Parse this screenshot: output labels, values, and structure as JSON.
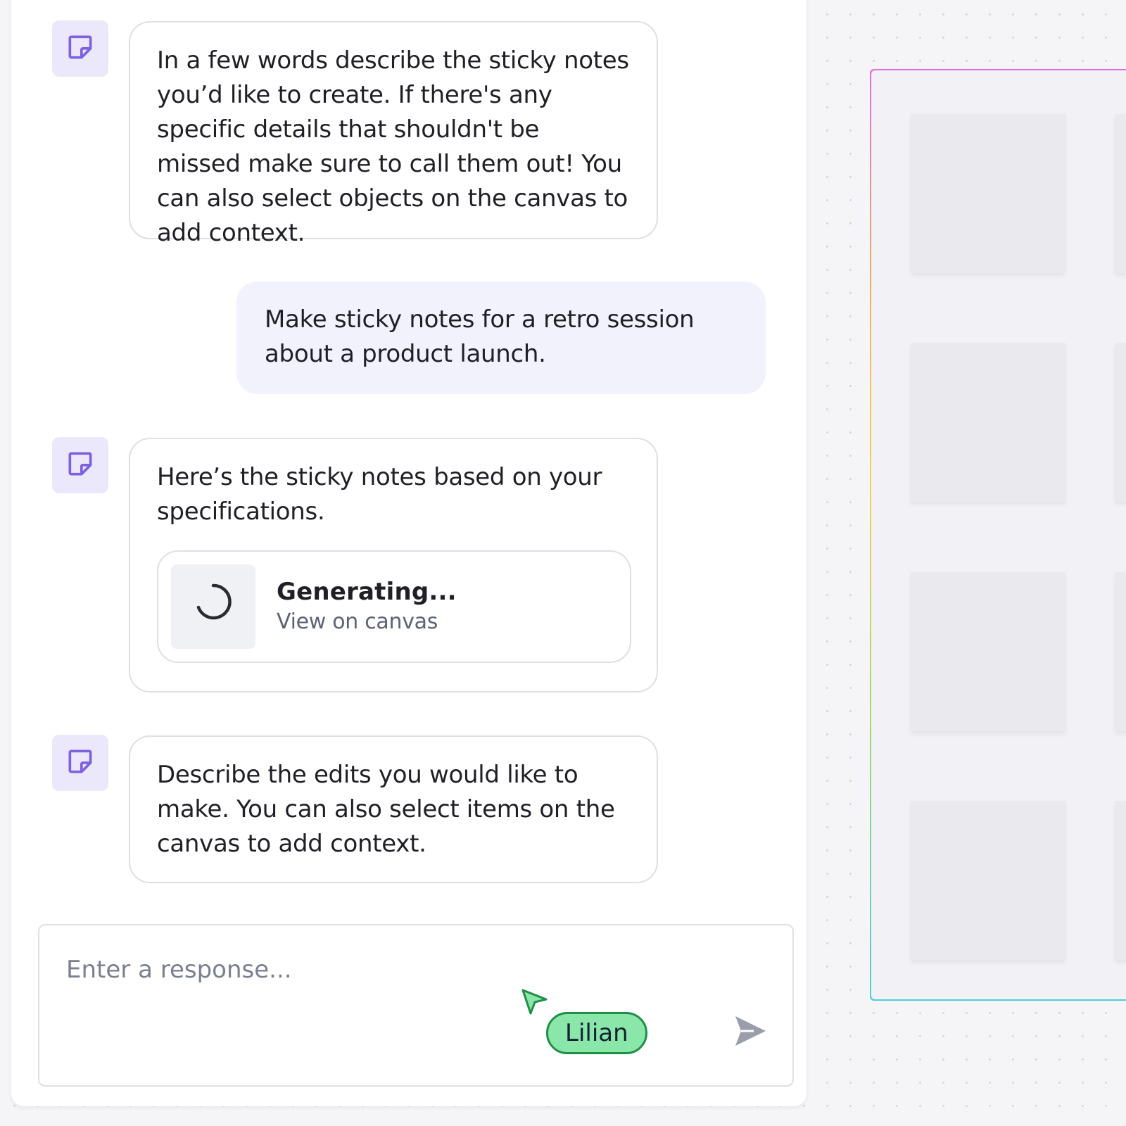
{
  "chat": {
    "messages": [
      {
        "role": "assistant",
        "text": "In a few words describe the sticky notes you’d like to create. If there's any specific details that shouldn't be missed make sure to call them out! You can also select objects on the canvas to add context."
      },
      {
        "role": "user",
        "text": "Make sticky notes for a retro session about a product launch."
      },
      {
        "role": "assistant",
        "text": "Here’s the sticky notes based on your specifications.",
        "card": {
          "title": "Generating...",
          "link": "View on canvas"
        }
      },
      {
        "role": "assistant",
        "text": "Describe the edits you would like to make. You can also select items on the canvas to add context."
      }
    ],
    "input": {
      "placeholder": "Enter a response...",
      "value": ""
    },
    "send_icon": "send-arrow-icon"
  },
  "collaborator_cursor": {
    "name": "Lilian",
    "color": "#8be6aa"
  },
  "canvas": {
    "frame_gradient": [
      "#e96ad8",
      "#f7b64a",
      "#f0d54a",
      "#a5d86a",
      "#4fcfd8"
    ],
    "sticky_color": "#e9e9ee"
  },
  "colors": {
    "accent": "#7c62e0",
    "avatar_bg": "#ebe8fb",
    "user_bubble": "#f1f2fc"
  }
}
